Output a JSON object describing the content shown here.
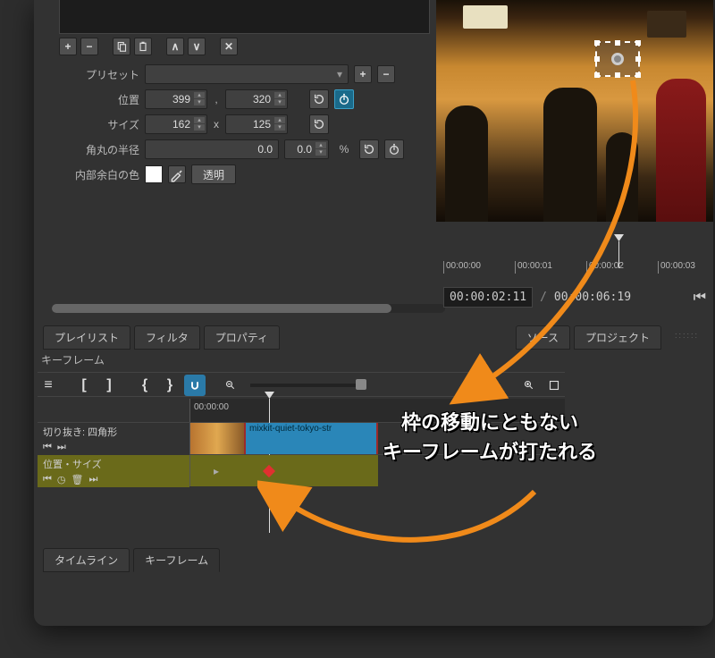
{
  "toolbar": {
    "add_label": "+",
    "remove_label": "−",
    "copy_label": "copy",
    "paste_label": "paste",
    "up_label": "∧",
    "down_label": "∨",
    "close_label": "✕"
  },
  "preset": {
    "label": "プリセット"
  },
  "position": {
    "label": "位置",
    "x": "399",
    "y": "320",
    "sep": ","
  },
  "size": {
    "label": "サイズ",
    "w": "162",
    "h": "125",
    "sep": "x"
  },
  "radius": {
    "label": "角丸の半径",
    "value": "0.0",
    "unit": "%"
  },
  "padcolor": {
    "label": "内部余白の色",
    "transparent": "透明"
  },
  "tabs": {
    "playlist": "プレイリスト",
    "filter": "フィルタ",
    "property": "プロパティ",
    "source": "ソース",
    "project": "プロジェクト",
    "timeline": "タイムライン",
    "keyframe": "キーフレーム"
  },
  "kf_panel_label": "キーフレーム",
  "kf_ruler": {
    "t0": "00:00:00"
  },
  "track1": {
    "name": "切り抜き: 四角形"
  },
  "clip": {
    "name": "mixkit-quiet-tokyo-str"
  },
  "track2": {
    "name": "位置・サイズ"
  },
  "preview_ruler": {
    "t0": "00:00:00",
    "t1": "00:00:01",
    "t2": "00:00:02",
    "t3": "00:00:03"
  },
  "timecode": {
    "current": "00:00:02:11",
    "total": "00:00:06:19",
    "sep": "/"
  },
  "annotation": {
    "line1": "枠の移動にともない",
    "line2": "キーフレームが打たれる"
  }
}
